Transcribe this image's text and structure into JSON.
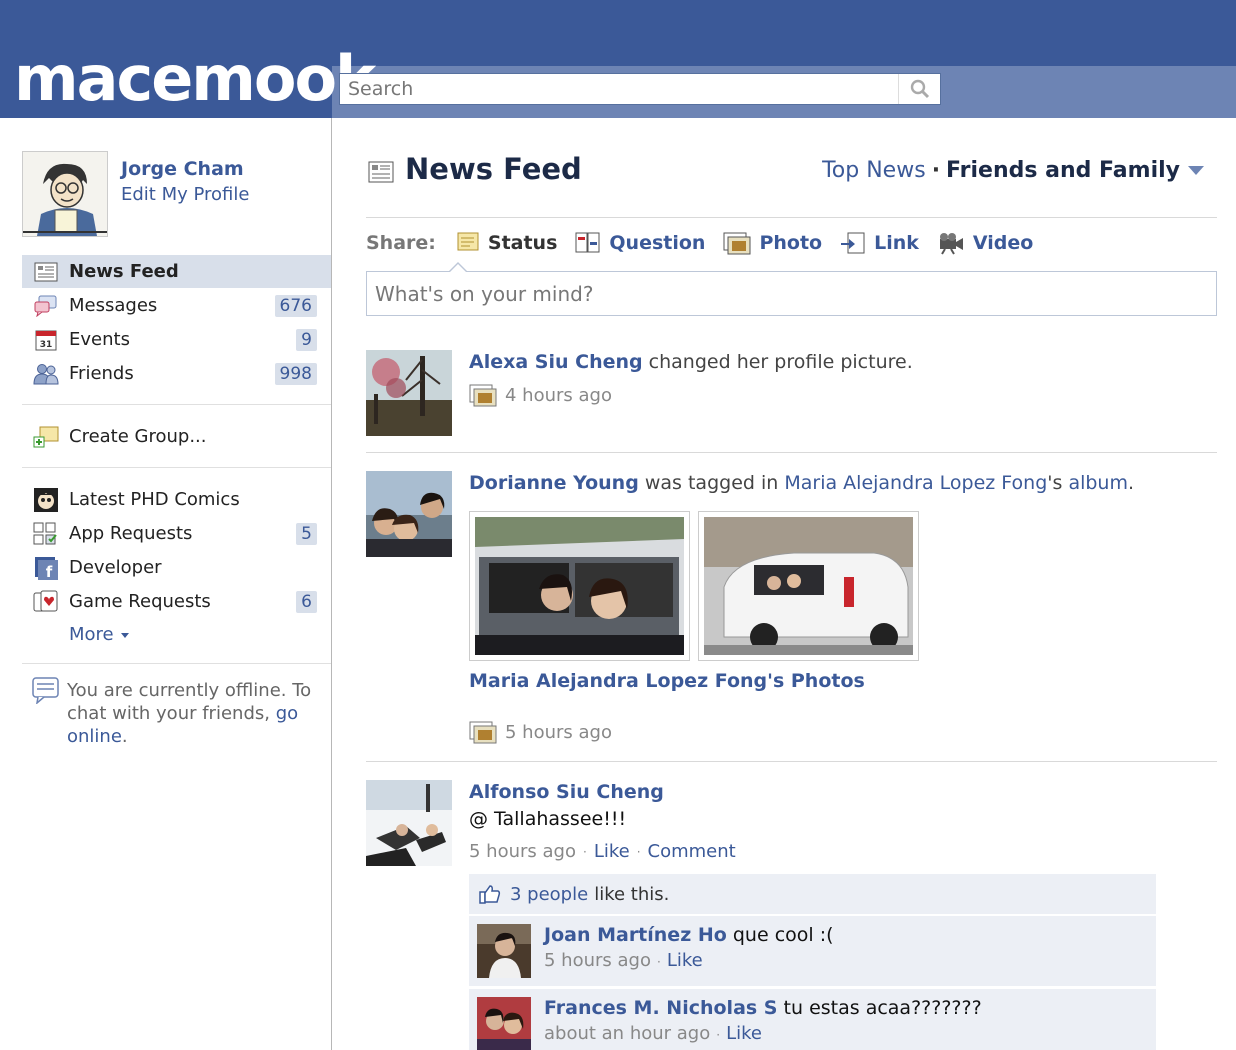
{
  "header": {
    "logo": "macemook",
    "search_placeholder": "Search"
  },
  "profile": {
    "name": "Jorge Cham",
    "edit_label": "Edit My Profile"
  },
  "nav": [
    {
      "label": "News Feed",
      "count": "",
      "icon": "news-feed-icon"
    },
    {
      "label": "Messages",
      "count": "676",
      "icon": "messages-icon"
    },
    {
      "label": "Events",
      "count": "9",
      "icon": "events-calendar-icon"
    },
    {
      "label": "Friends",
      "count": "998",
      "icon": "friends-icon"
    }
  ],
  "groups": {
    "create_label": "Create Group..."
  },
  "apps": [
    {
      "label": "Latest PHD Comics",
      "count": "",
      "icon": "phd-comics-icon"
    },
    {
      "label": "App Requests",
      "count": "5",
      "icon": "app-requests-icon"
    },
    {
      "label": "Developer",
      "count": "",
      "icon": "developer-icon"
    },
    {
      "label": "Game Requests",
      "count": "6",
      "icon": "game-requests-icon"
    }
  ],
  "more_label": "More",
  "chat": {
    "text_before": "You are currently offline. To chat with your friends,",
    "link": "go online",
    "text_after": "."
  },
  "feed": {
    "title": "News Feed",
    "filter_top": "Top News",
    "filter_current": "Friends and Family"
  },
  "share": {
    "label": "Share:",
    "items": [
      "Status",
      "Question",
      "Photo",
      "Link",
      "Video"
    ],
    "placeholder": "What's on your mind?"
  },
  "stories": [
    {
      "actor": "Alexa Siu Cheng",
      "text": "changed her profile picture.",
      "time": "4 hours ago"
    },
    {
      "actor": "Dorianne Young",
      "text_mid": "was tagged in",
      "owner": "Maria Alejandra Lopez Fong",
      "text_tail": "'s",
      "album": "album",
      "period": ".",
      "album_link": "Maria Alejandra Lopez Fong's Photos",
      "time": "5 hours ago"
    },
    {
      "actor": "Alfonso Siu Cheng",
      "message": "@ Tallahassee!!!",
      "time": "5 hours ago",
      "like": "Like",
      "comment": "Comment",
      "likes_link": "3 people",
      "likes_text": "like this."
    }
  ],
  "comments": [
    {
      "name": "Joan Martínez Ho",
      "text": "que cool :(",
      "time": "5 hours ago",
      "like": "Like"
    },
    {
      "name": "Frances M. Nicholas S",
      "text": "tu estas acaa???????",
      "time": "about an hour ago",
      "like": "Like"
    }
  ],
  "colors": {
    "brand": "#3b5998",
    "header_band": "#6d84b4",
    "highlight": "#d8dfea"
  }
}
